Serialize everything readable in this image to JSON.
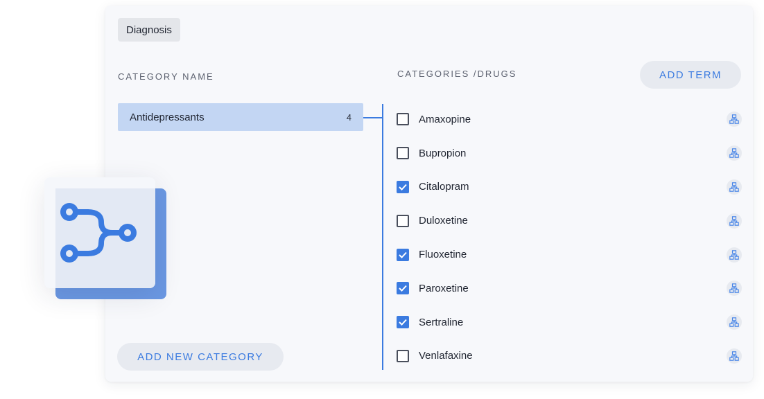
{
  "header": {
    "chip_label": "Diagnosis"
  },
  "left": {
    "column_title": "CATEGORY NAME",
    "category": {
      "name": "Antidepressants",
      "count": "4"
    },
    "add_category_label": "ADD NEW CATEGORY"
  },
  "right": {
    "column_title": "CATEGORIES /DRUGS",
    "add_term_label": "ADD TERM",
    "drugs": [
      {
        "label": "Amaxopine",
        "checked": false
      },
      {
        "label": "Bupropion",
        "checked": false
      },
      {
        "label": "Citalopram",
        "checked": true
      },
      {
        "label": "Duloxetine",
        "checked": false
      },
      {
        "label": "Fluoxetine",
        "checked": true
      },
      {
        "label": "Paroxetine",
        "checked": true
      },
      {
        "label": "Sertraline",
        "checked": true
      },
      {
        "label": "Venlafaxine",
        "checked": false
      }
    ]
  },
  "icons": {
    "row_action": "hierarchy-icon",
    "feature": "branch-merge-icon"
  },
  "colors": {
    "accent": "#3b7be0",
    "selected_row": "#c3d6f3",
    "feature_back": "#6b98e3"
  }
}
